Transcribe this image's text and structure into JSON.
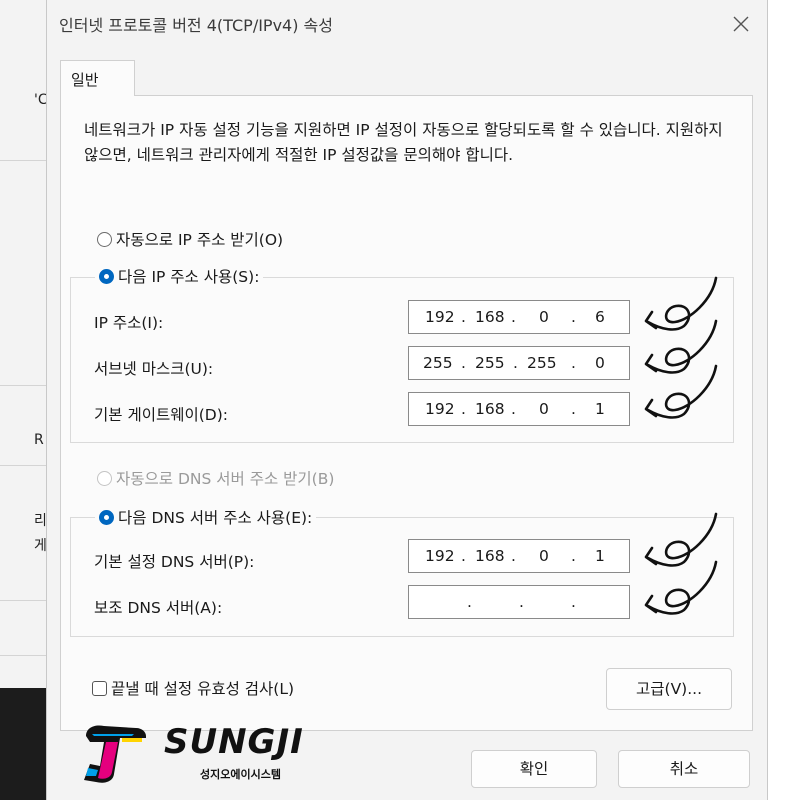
{
  "background": {
    "fragments": [
      "'C",
      "R",
      "리",
      "게"
    ]
  },
  "window": {
    "title": "인터넷 프로토콜 버전 4(TCP/IPv4) 속성",
    "close_icon": "close-icon"
  },
  "tabs": [
    {
      "label": "일반",
      "selected": true
    }
  ],
  "description": "네트워크가 IP 자동 설정 기능을 지원하면 IP 설정이 자동으로 할당되도록 할 수 있습니다. 지원하지 않으면, 네트워크 관리자에게 적절한 IP 설정값을 문의해야 합니다.",
  "ip_section": {
    "auto_radio": {
      "label": "자동으로 IP 주소 받기(O)",
      "checked": false
    },
    "manual_radio": {
      "label": "다음 IP 주소 사용(S):",
      "checked": true
    },
    "fields": [
      {
        "label": "IP 주소(I):",
        "octets": [
          "192",
          "168",
          "0",
          "6"
        ]
      },
      {
        "label": "서브넷 마스크(U):",
        "octets": [
          "255",
          "255",
          "255",
          "0"
        ]
      },
      {
        "label": "기본 게이트웨이(D):",
        "octets": [
          "192",
          "168",
          "0",
          "1"
        ]
      }
    ]
  },
  "dns_section": {
    "auto_radio": {
      "label": "자동으로 DNS 서버 주소 받기(B)",
      "checked": false,
      "disabled": true
    },
    "manual_radio": {
      "label": "다음 DNS 서버 주소 사용(E):",
      "checked": true
    },
    "fields": [
      {
        "label": "기본 설정 DNS 서버(P):",
        "octets": [
          "192",
          "168",
          "0",
          "1"
        ]
      },
      {
        "label": "보조 DNS 서버(A):",
        "octets": [
          "",
          "",
          "",
          ""
        ]
      }
    ]
  },
  "validate_checkbox": {
    "label": "끝낼 때 설정 유효성 검사(L)",
    "checked": false
  },
  "buttons": {
    "advanced": "고급(V)...",
    "ok": "확인",
    "cancel": "취소"
  },
  "logo": {
    "name": "SUNGJI",
    "subtitle": "성지오에이시스템"
  },
  "colors": {
    "accent": "#0067c0",
    "logo_magenta": "#e5007e",
    "logo_cyan": "#00a0e9",
    "logo_yellow": "#ffd400"
  }
}
